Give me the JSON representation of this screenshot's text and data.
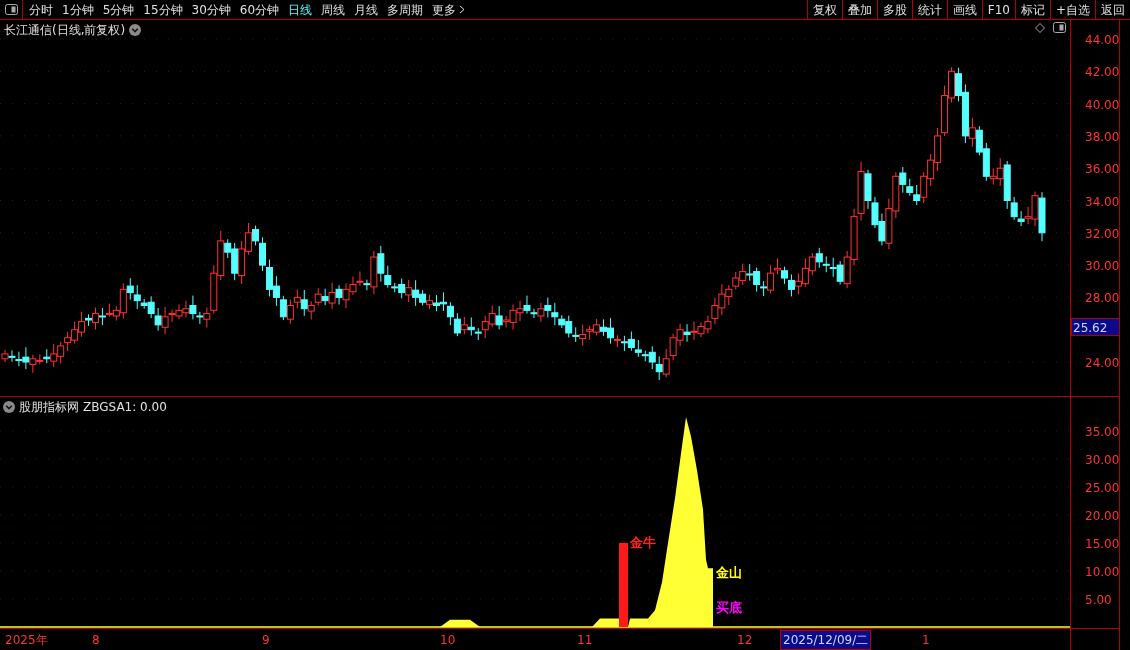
{
  "toolbar": {
    "periods": [
      {
        "label": "分时",
        "selected": false
      },
      {
        "label": "1分钟",
        "selected": false
      },
      {
        "label": "5分钟",
        "selected": false
      },
      {
        "label": "15分钟",
        "selected": false
      },
      {
        "label": "30分钟",
        "selected": false
      },
      {
        "label": "60分钟",
        "selected": false
      },
      {
        "label": "日线",
        "selected": true
      },
      {
        "label": "周线",
        "selected": false
      },
      {
        "label": "月线",
        "selected": false
      },
      {
        "label": "多周期",
        "selected": false
      },
      {
        "label": "更多",
        "selected": false
      }
    ],
    "buttons": [
      "复权",
      "叠加",
      "多股",
      "统计",
      "画线",
      "F10",
      "标记",
      "+自选",
      "返回"
    ]
  },
  "main_chart": {
    "title": "长江通信(日线,前复权)",
    "price_ticks": [
      "44.00",
      "42.00",
      "40.00",
      "38.00",
      "36.00",
      "34.00",
      "32.00",
      "30.00",
      "28.00",
      "24.00"
    ],
    "current_price": "25.62"
  },
  "indicator": {
    "name": "股朋指标网",
    "series": "ZBGSA1:",
    "value": "0.00",
    "ticks": [
      "35.00",
      "30.00",
      "25.00",
      "20.00",
      "15.00",
      "10.00",
      "5.00"
    ],
    "signals": [
      {
        "text": "金牛",
        "color": "#ff2020"
      },
      {
        "text": "金山",
        "color": "#ffff00"
      },
      {
        "text": "买底",
        "color": "#ff00ff"
      }
    ]
  },
  "date_axis": {
    "labels": [
      "2025年",
      "8",
      "9",
      "10",
      "11",
      "12",
      "1"
    ],
    "cursor_date": "2025/12/09/二"
  }
}
